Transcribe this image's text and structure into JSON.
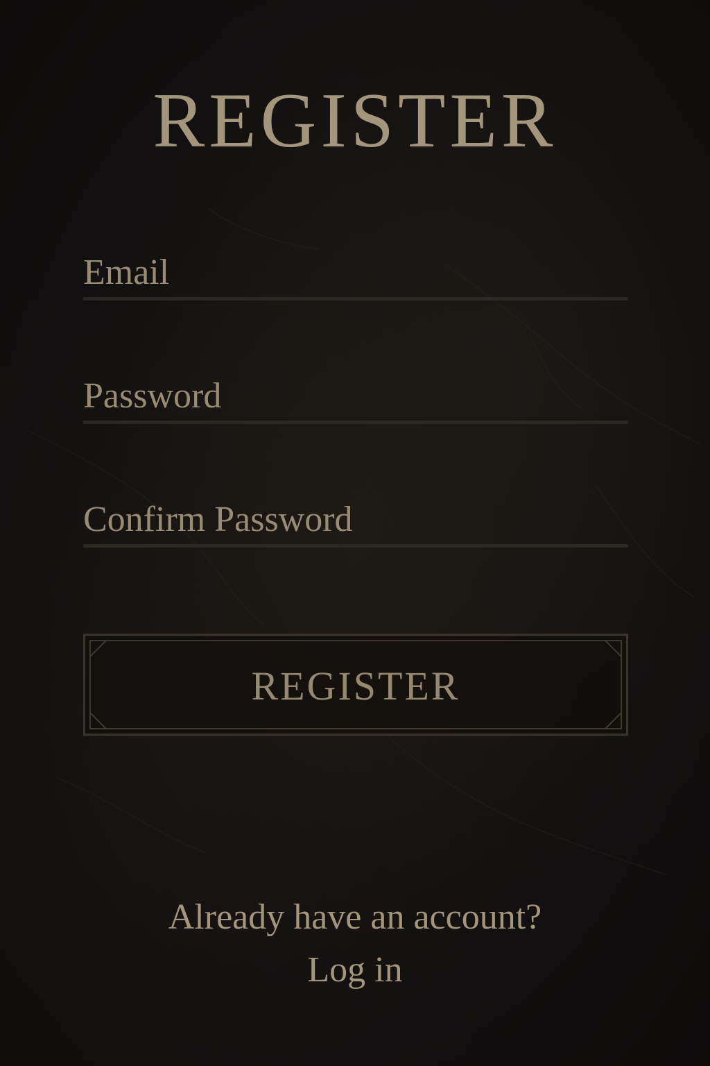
{
  "page": {
    "title": "REGISTER"
  },
  "form": {
    "email_placeholder": "Email",
    "password_placeholder": "Password",
    "confirm_placeholder": "Confirm Password",
    "submit_label": "REGISTER"
  },
  "footer": {
    "prompt": "Already have an account?",
    "login_label": "Log in"
  },
  "colors": {
    "background": "#121010",
    "text": "#a3967c",
    "underline": "#2b2722",
    "button_border": "#3a342c"
  }
}
